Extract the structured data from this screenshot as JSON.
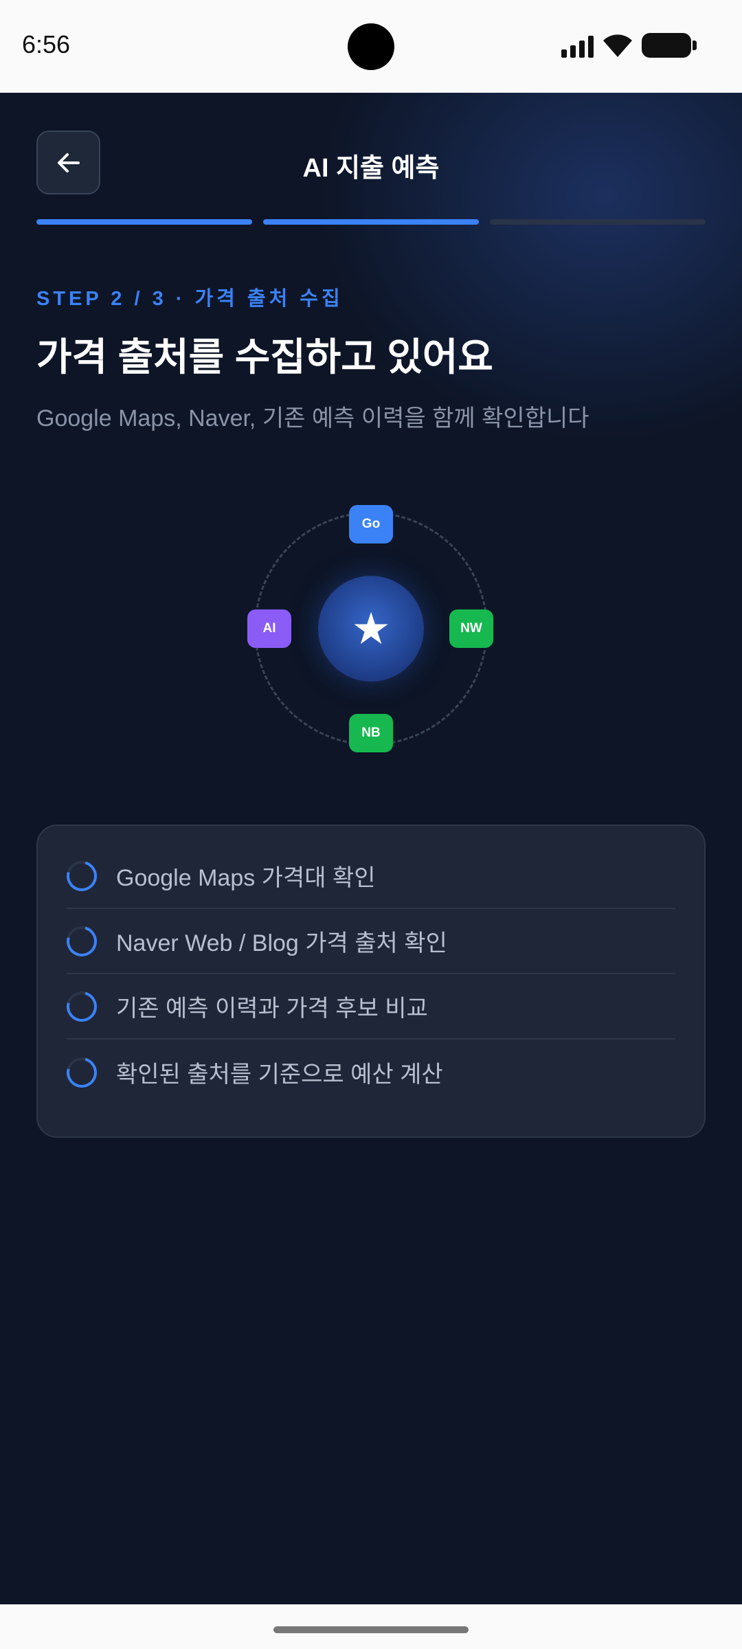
{
  "status_bar": {
    "time": "6:56"
  },
  "header": {
    "title": "AI 지출 예측",
    "back_icon": "arrow-left-icon"
  },
  "progress": {
    "total_steps": 3,
    "current_step": 2,
    "colors": {
      "active": "#3b82f6",
      "inactive": "#2a3448"
    }
  },
  "step": {
    "label": "STEP 2 / 3 · 가격 출처 수집",
    "title": "가격 출처를 수집하고 있어요",
    "subtitle": "Google Maps, Naver, 기존 예측 이력을 함께 확인합니다"
  },
  "sources": {
    "center_icon": "star-icon",
    "chips": [
      {
        "label": "Go",
        "color": "#3b82f6"
      },
      {
        "label": "NW",
        "color": "#16b84f"
      },
      {
        "label": "NB",
        "color": "#16b84f"
      },
      {
        "label": "AI",
        "color": "#8b5cf6"
      }
    ]
  },
  "checklist": [
    {
      "label": "Google Maps 가격대 확인",
      "state_icon": "loading-spinner-icon"
    },
    {
      "label": "Naver Web / Blog 가격 출처 확인",
      "state_icon": "loading-spinner-icon"
    },
    {
      "label": "기존 예측 이력과 가격 후보 비교",
      "state_icon": "loading-spinner-icon"
    },
    {
      "label": "확인된 출처를 기준으로 예산 계산",
      "state_icon": "loading-spinner-icon"
    }
  ],
  "theme": {
    "background": "#0d1526",
    "accent": "#3b82f6",
    "card": "#1f2637"
  }
}
